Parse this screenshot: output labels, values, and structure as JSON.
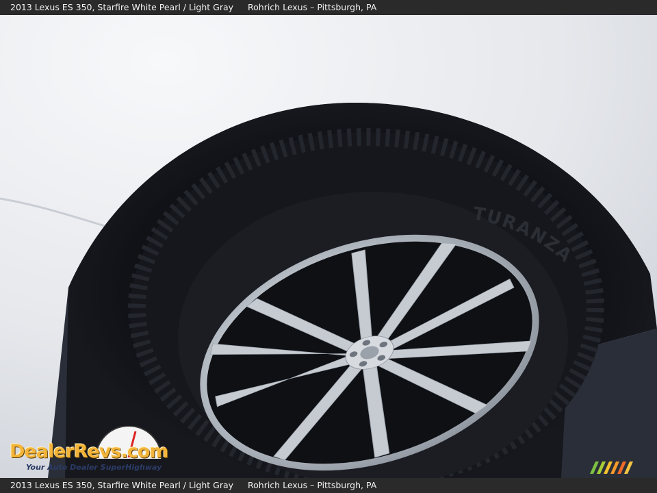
{
  "caption": {
    "vehicle": "2013 Lexus ES 350,  Starfire White Pearl / Light Gray",
    "dealer": "Rohrich Lexus – Pittsburgh, PA"
  },
  "caption_bottom": {
    "vehicle": "2013 Lexus ES 350,  Starfire White Pearl / Light Gray",
    "dealer": "Rohrich Lexus – Pittsburgh, PA"
  },
  "tire": {
    "brand_text": "TURANZA"
  },
  "watermark": {
    "brand": "DealerRevs.com",
    "tagline": "Your Auto Dealer SuperHighway"
  },
  "colors": {
    "car_paint": "#e9ebee",
    "tire": "#15171c",
    "wheel": "#b9bfc7",
    "asphalt": "#2a2e38",
    "caption_bar": "#2a2a2a",
    "watermark_orange": "#f3b43a"
  }
}
